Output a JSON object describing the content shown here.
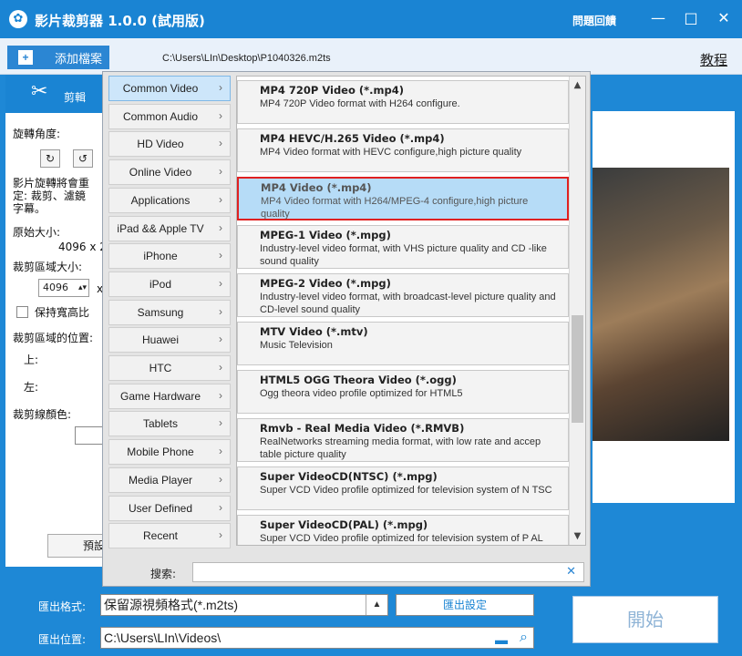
{
  "window": {
    "title": "影片裁剪器 1.0.0 (試用版)",
    "feedback": "問題回饋",
    "minimize": "—",
    "maximize": "□",
    "close": "✕"
  },
  "toolbar": {
    "add_file": "添加檔案",
    "file_path": "C:\\Users\\LIn\\Desktop\\P1040326.m2ts",
    "tutorial": "教程"
  },
  "left_panel": {
    "edit_tab": "剪輯",
    "rotation_label": "旋轉角度:",
    "rotate_left": "↻",
    "rotate_right": "↺",
    "rotation_note_1": "影片旋轉將會重",
    "rotation_note_2": "定: 裁剪、濾鏡",
    "rotation_note_3": "字幕。",
    "original_size_label": "原始大小:",
    "original_size_value": "4096 x 2",
    "crop_size_label": "裁剪區域大小:",
    "crop_width": "4096",
    "crop_x": "x",
    "keep_ratio": "保持寬高比",
    "crop_position_label": "裁剪區域的位置:",
    "top_label": "上:",
    "left_label": "左:",
    "crop_line_color": "裁剪線顏色:",
    "preset": "預設"
  },
  "categories": [
    {
      "label": "Common Video",
      "active": true
    },
    {
      "label": "Common Audio",
      "active": false
    },
    {
      "label": "HD Video",
      "active": false
    },
    {
      "label": "Online Video",
      "active": false
    },
    {
      "label": "Applications",
      "active": false
    },
    {
      "label": "iPad && Apple TV",
      "active": false
    },
    {
      "label": "iPhone",
      "active": false
    },
    {
      "label": "iPod",
      "active": false
    },
    {
      "label": "Samsung",
      "active": false
    },
    {
      "label": "Huawei",
      "active": false
    },
    {
      "label": "HTC",
      "active": false
    },
    {
      "label": "Game Hardware",
      "active": false
    },
    {
      "label": "Tablets",
      "active": false
    },
    {
      "label": "Mobile Phone",
      "active": false
    },
    {
      "label": "Media Player",
      "active": false
    },
    {
      "label": "User Defined",
      "active": false
    },
    {
      "label": "Recent",
      "active": false
    }
  ],
  "formats": [
    {
      "title": "MP4 720P Video (*.mp4)",
      "desc": "MP4 720P Video format with H264 configure.",
      "selected": false
    },
    {
      "title": "MP4 HEVC/H.265 Video (*.mp4)",
      "desc": "MP4 Video format with HEVC configure,high picture quality",
      "selected": false
    },
    {
      "title": "MP4 Video (*.mp4)",
      "desc": "MP4 Video format with H264/MPEG-4 configure,high picture quality",
      "selected": true
    },
    {
      "title": "MPEG-1 Video (*.mpg)",
      "desc": "Industry-level video format, with VHS picture quality and CD -like sound quality",
      "selected": false
    },
    {
      "title": "MPEG-2 Video (*.mpg)",
      "desc": "Industry-level video format, with broadcast-level picture quality and CD-level sound quality",
      "selected": false
    },
    {
      "title": "MTV Video (*.mtv)",
      "desc": "Music Television",
      "selected": false
    },
    {
      "title": "HTML5 OGG Theora Video (*.ogg)",
      "desc": "Ogg theora video profile optimized for HTML5",
      "selected": false
    },
    {
      "title": "Rmvb - Real Media Video (*.RMVB)",
      "desc": "RealNetworks streaming media format, with low rate and accep table picture quality",
      "selected": false
    },
    {
      "title": "Super VideoCD(NTSC) (*.mpg)",
      "desc": "Super VCD Video profile optimized for television system of N TSC",
      "selected": false
    },
    {
      "title": "Super VideoCD(PAL) (*.mpg)",
      "desc": "Super VCD Video profile optimized for television system of P AL",
      "selected": false
    }
  ],
  "search": {
    "label": "搜索:",
    "value": "",
    "clear": "✕"
  },
  "bottom": {
    "export_format_label": "匯出格式:",
    "export_format_value": "保留源視頻格式(*.m2ts)",
    "export_settings": "匯出設定",
    "export_location_label": "匯出位置:",
    "export_location_value": "C:\\Users\\LIn\\Videos\\",
    "start": "開始"
  },
  "colors": {
    "accent": "#1a84d3",
    "selected_bg": "#b6dcf7",
    "selected_border": "#e02020"
  }
}
